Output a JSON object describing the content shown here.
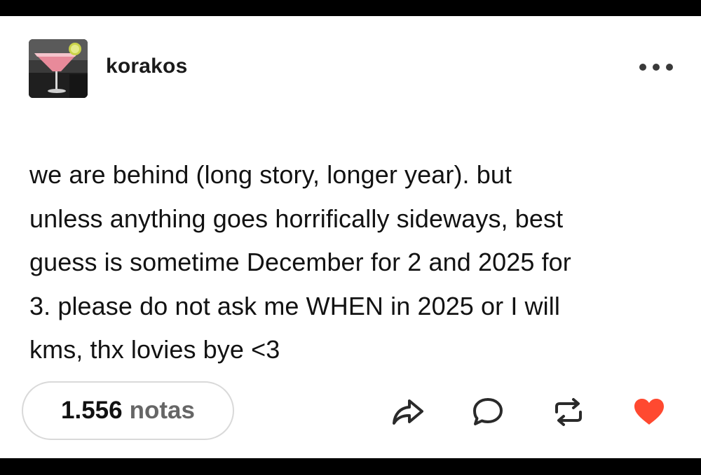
{
  "post": {
    "author": "korakos",
    "body_lines": [
      "we are behind (long story, longer year). but",
      "unless anything goes horrifically sideways, best",
      "guess is sometime December for 2 and 2025 for",
      "3. please do not ask me WHEN in 2025 or I will",
      "kms, thx lovies bye <3"
    ],
    "notes_count": "1.556",
    "notes_label": "notas"
  },
  "icons": {
    "more": "more-options-icon",
    "share": "share-icon",
    "reply": "reply-icon",
    "reblog": "reblog-icon",
    "like": "heart-icon"
  },
  "colors": {
    "like_active": "#ff4930",
    "icon_stroke": "#2a2a2a",
    "background": "#ffffff",
    "frame": "#000000"
  }
}
